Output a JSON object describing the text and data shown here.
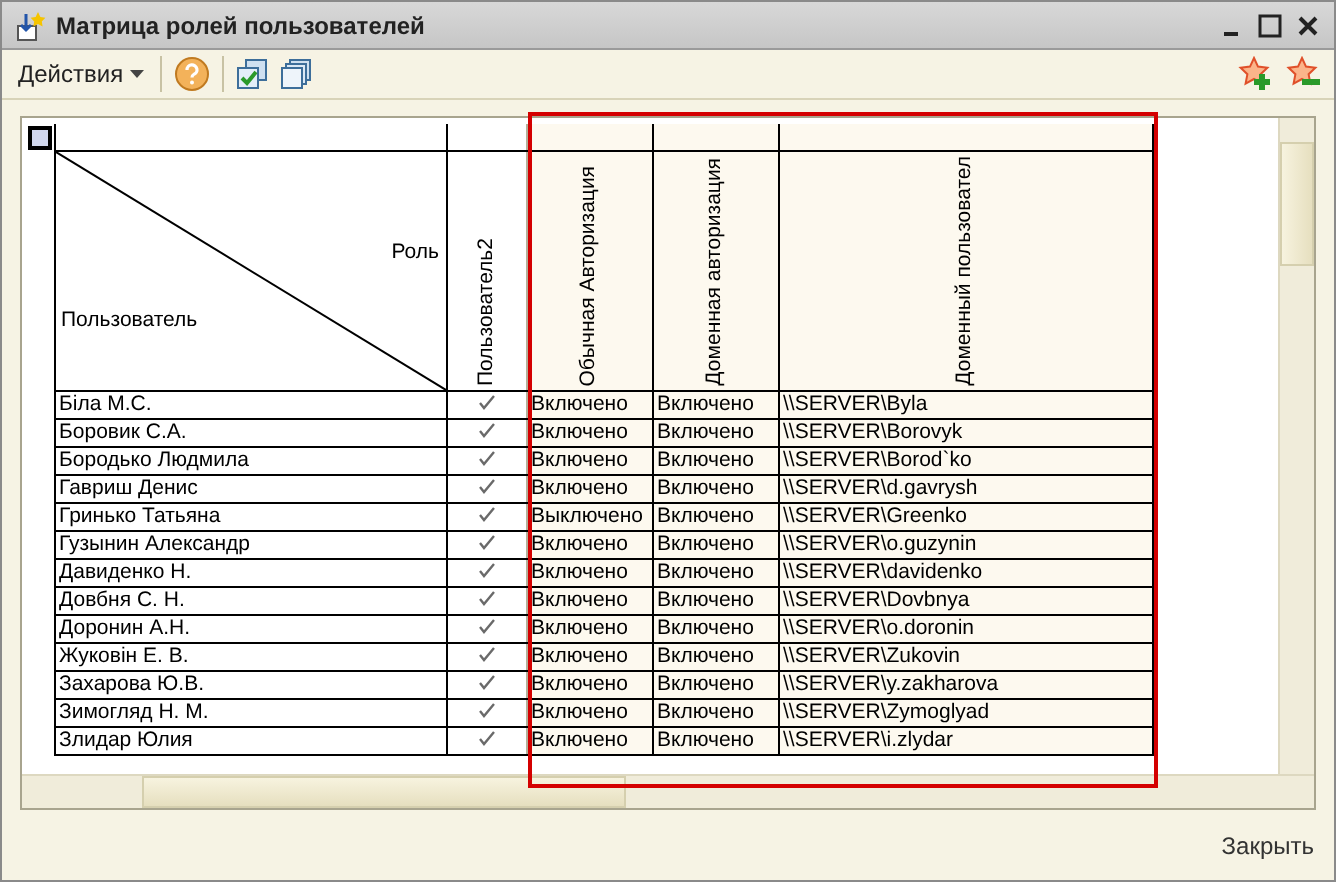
{
  "window": {
    "title": "Матрица ролей пользователей"
  },
  "toolbar": {
    "actions_menu": "Действия"
  },
  "table": {
    "corner": {
      "row_label": "Роль",
      "column_label": "Пользователь"
    },
    "columns": [
      "Пользователь2",
      "Обычная Авторизация",
      "Доменная авторизация",
      "Доменный пользовател"
    ],
    "rows": [
      {
        "name": "Біла М.С.",
        "user2": true,
        "auth": "Включено",
        "domain_auth": "Включено",
        "domain_user": "\\\\SERVER\\Byla"
      },
      {
        "name": "Боровик С.А.",
        "user2": true,
        "auth": "Включено",
        "domain_auth": "Включено",
        "domain_user": "\\\\SERVER\\Borovyk"
      },
      {
        "name": "Бородько Людмила",
        "user2": true,
        "auth": "Включено",
        "domain_auth": "Включено",
        "domain_user": "\\\\SERVER\\Borod`ko"
      },
      {
        "name": "Гавриш Денис",
        "user2": true,
        "auth": "Включено",
        "domain_auth": "Включено",
        "domain_user": "\\\\SERVER\\d.gavrysh"
      },
      {
        "name": "Гринько Татьяна",
        "user2": true,
        "auth": "Выключено",
        "domain_auth": "Включено",
        "domain_user": "\\\\SERVER\\Greenko"
      },
      {
        "name": "Гузынин Александр",
        "user2": true,
        "auth": "Включено",
        "domain_auth": "Включено",
        "domain_user": "\\\\SERVER\\o.guzynin"
      },
      {
        "name": "Давиденко Н.",
        "user2": true,
        "auth": "Включено",
        "domain_auth": "Включено",
        "domain_user": "\\\\SERVER\\davidenko"
      },
      {
        "name": "Довбня С. Н.",
        "user2": true,
        "auth": "Включено",
        "domain_auth": "Включено",
        "domain_user": "\\\\SERVER\\Dovbnya"
      },
      {
        "name": "Доронин А.Н.",
        "user2": true,
        "auth": "Включено",
        "domain_auth": "Включено",
        "domain_user": "\\\\SERVER\\o.doronin"
      },
      {
        "name": "Жуковін Е. В.",
        "user2": true,
        "auth": "Включено",
        "domain_auth": "Включено",
        "domain_user": "\\\\SERVER\\Zukovin"
      },
      {
        "name": "Захарова Ю.В.",
        "user2": true,
        "auth": "Включено",
        "domain_auth": "Включено",
        "domain_user": "\\\\SERVER\\y.zakharova"
      },
      {
        "name": "Зимогляд Н. М.",
        "user2": true,
        "auth": "Включено",
        "domain_auth": "Включено",
        "domain_user": "\\\\SERVER\\Zymoglyad"
      },
      {
        "name": "Злидар Юлия",
        "user2": true,
        "auth": "Включено",
        "domain_auth": "Включено",
        "domain_user": "\\\\SERVER\\i.zlydar"
      }
    ]
  },
  "footer": {
    "close_button": "Закрыть"
  }
}
